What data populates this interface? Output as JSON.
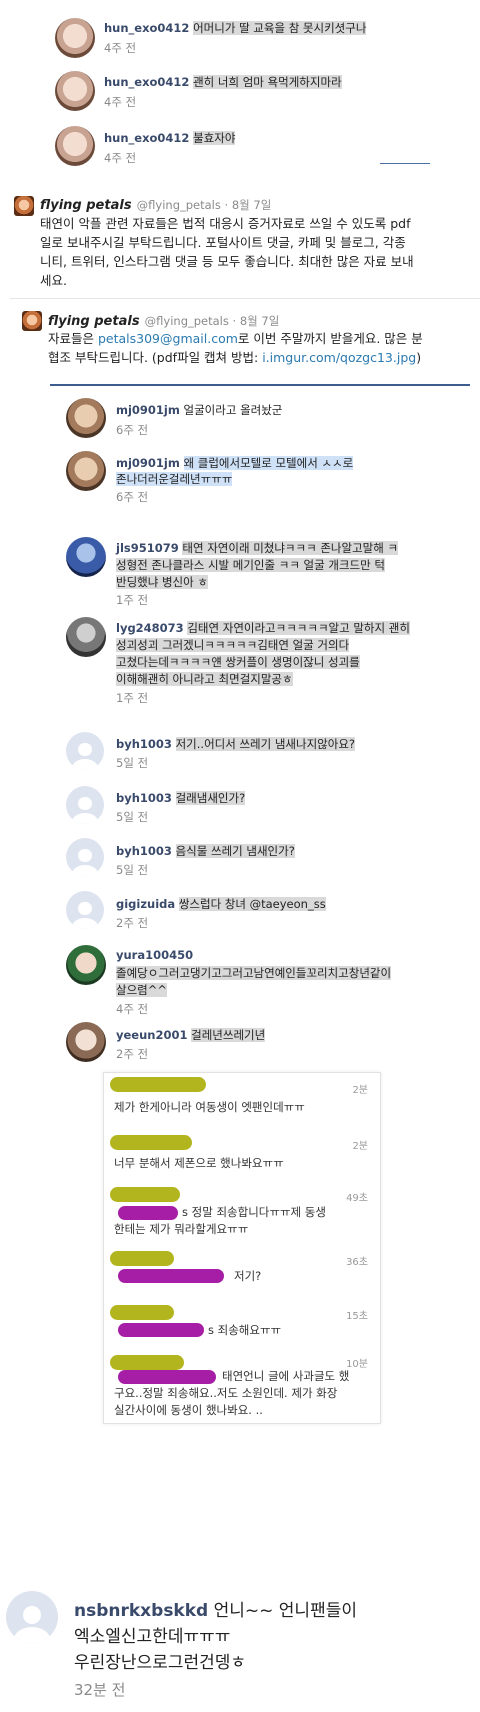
{
  "section1": [
    {
      "user": "hun_exo0412",
      "text": "어머니가 딸 교육을 참 못시키셧구나",
      "time": "4주 전"
    },
    {
      "user": "hun_exo0412",
      "text": "괜히 너희 엄마 욕먹게하지마라",
      "time": "4주 전"
    },
    {
      "user": "hun_exo0412",
      "text": "불효자야",
      "time": "4주 전"
    }
  ],
  "tweet1": {
    "name": "flying petals",
    "handle": "@flying_petals · 8월 7일",
    "lines": [
      "태연이 악플 관련 자료들은 법적 대응시 증거자료로 쓰일 수 있도록 pdf",
      "일로 보내주시길 부탁드립니다. 포털사이트 댓글, 카페 및 블로그, 각종",
      "니티, 트위터, 인스타그램 댓글 등 모두 좋습니다. 최대한 많은 자료 보내",
      "세요."
    ]
  },
  "tweet2": {
    "name": "flying petals",
    "handle": "@flying_petals · 8월 7일",
    "line1_pre": "자료들은 ",
    "line1_email": "petals309@gmail.com",
    "line1_post": "로 이번 주말까지 받을게요. 많은 분",
    "line2_pre": "협조 부탁드립니다. (pdf파일 캡쳐 방법: ",
    "line2_link": "i.imgur.com/qozgc13.jpg",
    "line2_post": ")"
  },
  "section2": [
    {
      "user": "mj0901jm",
      "lines": [
        "얼굴이라고 올려놨군"
      ],
      "time": "6주 전"
    },
    {
      "user": "mj0901jm",
      "lines": [
        "왜 클럽에서모텔로 모텔에서 ㅅㅅ로",
        "존나더러운걸레년ㅠㅠㅠ"
      ],
      "time": "6주 전"
    },
    {
      "user": "jls951079",
      "lines": [
        "태연 자연이래 미쳤냐ㅋㅋㅋ 존나알고말해 ㅋ",
        "성형전 존나클라스 시발 메기인줄 ㅋㅋ 얼굴 개크드만  턱",
        "반딩했냐 병신아 ㅎ"
      ],
      "time": "1주 전"
    },
    {
      "user": "lyg248073",
      "lines": [
        "김태연 자연이라고ㅋㅋㅋㅋㅋ알고 말하지 괜히",
        "성괴성괴 그러겠니ㅋㅋㅋㅋㅋ김태연 얼굴 거의다",
        "고쳤다는데ㅋㅋㅋㅋ얜 쌍커플이 생명이잖니 성괴를",
        "이해해괜히 아니라고 최면걸지말공ㅎ"
      ],
      "time": "1주 전"
    },
    {
      "user": "byh1003",
      "lines": [
        "저기..어디서 쓰레기 냄새나지않아요?"
      ],
      "time": "5일 전"
    },
    {
      "user": "byh1003",
      "lines": [
        "걸래냄새인가?"
      ],
      "time": "5일 전"
    },
    {
      "user": "byh1003",
      "lines": [
        "음식물 쓰레기 냄새인가?"
      ],
      "time": "5일 전"
    },
    {
      "user": "gigizuida",
      "lines": [
        "쌍스럽다 창녀 @taeyeon_ss"
      ],
      "time": "2주 전"
    },
    {
      "user": "yura100450",
      "lines": [
        "졸예당ㅇ그러고댕기고그러고남연예인들꼬리치고창년같이",
        "살으렴^^"
      ],
      "time": "4주 전"
    },
    {
      "user": "yeeun2001",
      "lines": [
        "걸레년쓰레기년"
      ],
      "time": "2주 전"
    }
  ],
  "kakao": [
    {
      "time": "2분",
      "lines": [
        "제가 한게아니라 여동생이 엣팬인데ㅠㅠ"
      ]
    },
    {
      "time": "2분",
      "lines": [
        "너무 분해서 제폰으로 했나봐요ㅠㅠ"
      ]
    },
    {
      "time": "49초",
      "lines": [
        "s 정말 죄송합니다ㅠㅠ제 동생",
        "한테는 제가 뭐라할게요ㅠㅠ"
      ]
    },
    {
      "time": "36초",
      "lines": [
        "저기?"
      ]
    },
    {
      "time": "15초",
      "lines": [
        "s 죄송해요ㅠㅠ"
      ]
    },
    {
      "time": "10분",
      "lines": [
        "태연언니 글에 사과글도 했",
        "구요..정말 죄송해요..저도 소원인데. 제가 화장",
        "실간사이에 동생이 했나봐요.  .."
      ]
    }
  ],
  "bottom": {
    "user": "nsbnrkxbskkd",
    "line1": "언니~~ 언니팬들이",
    "line2": "엑소엘신고한데ㅠㅠㅠ",
    "line3": "우린장난으로그런건뎅ㅎ",
    "time": "32분 전"
  }
}
